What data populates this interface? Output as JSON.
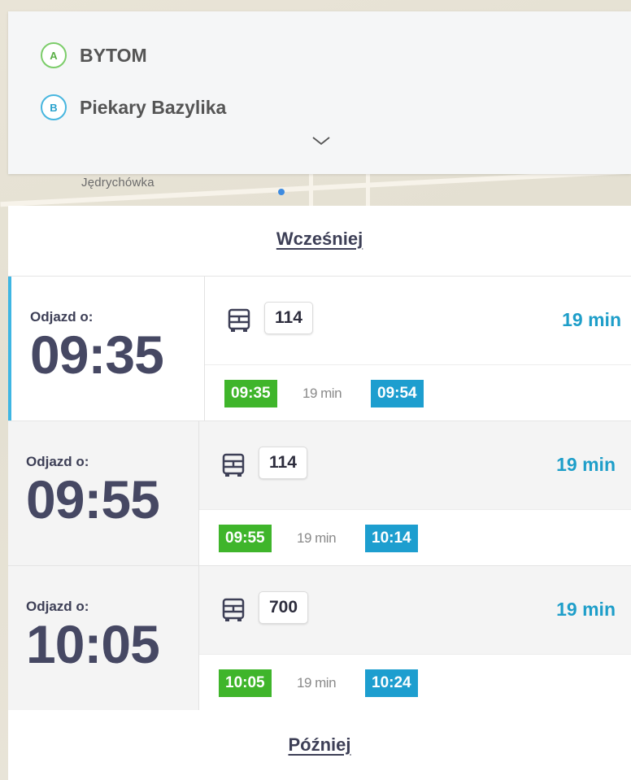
{
  "route": {
    "origin": {
      "badge": "A",
      "name": "BYTOM"
    },
    "destination": {
      "badge": "B",
      "name": "Piekary Bazylika"
    },
    "expand_icon": "chevron-down-icon"
  },
  "map": {
    "label": "Jędrychówka"
  },
  "nav": {
    "earlier": "Wcześniej",
    "later": "Później"
  },
  "trips": [
    {
      "depart_label": "Odjazd o:",
      "depart_time": "09:35",
      "mode_icon": "bus-icon",
      "line": "114",
      "duration": "19 min",
      "start": "09:35",
      "leg_duration": "19 min",
      "end": "09:54",
      "selected": true
    },
    {
      "depart_label": "Odjazd o:",
      "depart_time": "09:55",
      "mode_icon": "bus-icon",
      "line": "114",
      "duration": "19 min",
      "start": "09:55",
      "leg_duration": "19 min",
      "end": "10:14",
      "selected": false
    },
    {
      "depart_label": "Odjazd o:",
      "depart_time": "10:05",
      "mode_icon": "bus-icon",
      "line": "700",
      "duration": "19 min",
      "start": "10:05",
      "leg_duration": "19 min",
      "end": "10:24",
      "selected": false
    }
  ],
  "colors": {
    "accent": "#3fb6e3",
    "origin": "#7ccd6a",
    "destination": "#47b6df",
    "start_chip": "#3fb52b",
    "end_chip": "#1d9ecf",
    "duration": "#1e9ec9"
  }
}
